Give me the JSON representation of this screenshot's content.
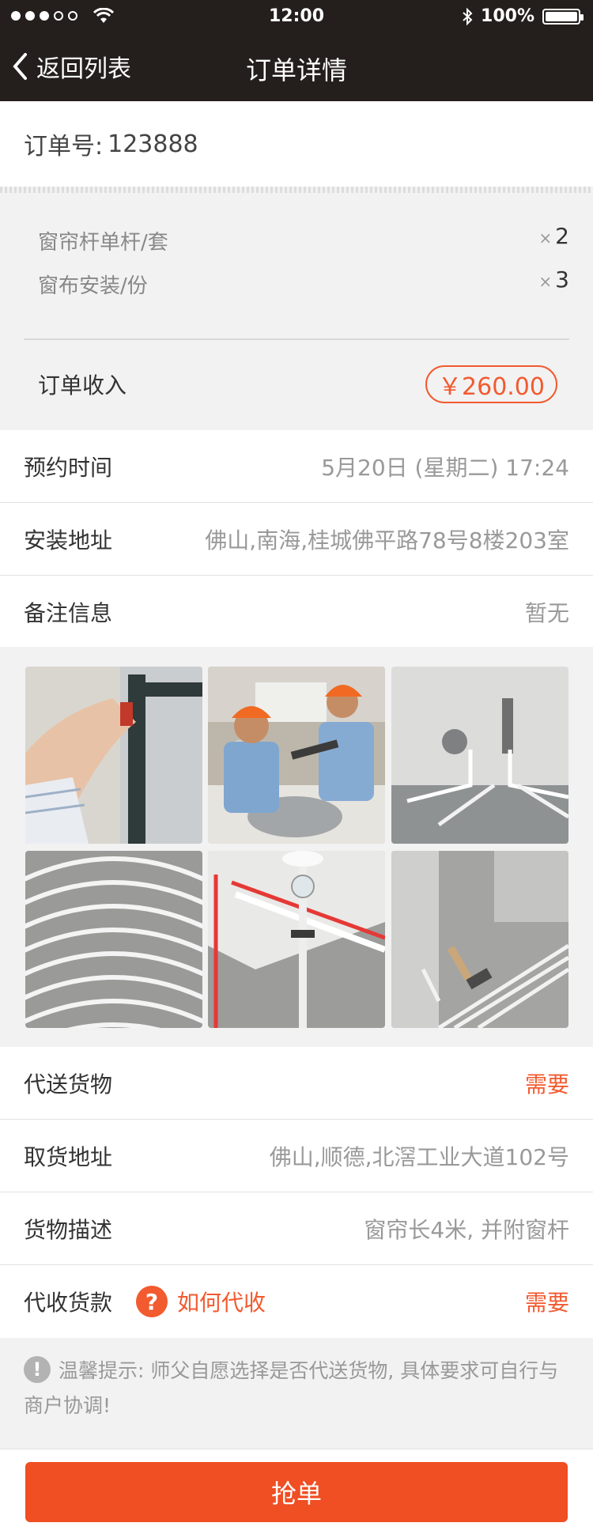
{
  "status": {
    "time": "12:00",
    "battery": "100%",
    "signal_filled": 3,
    "signal_empty": 2
  },
  "nav": {
    "back_label": "返回列表",
    "title": "订单详情"
  },
  "order": {
    "label": "订单号:",
    "number": "123888"
  },
  "items": [
    {
      "name": "窗帘杆单杆/套",
      "qty_prefix": "×",
      "qty": "2"
    },
    {
      "name": "窗布安装/份",
      "qty_prefix": "×",
      "qty": "3"
    }
  ],
  "income": {
    "label": "订单收入",
    "amount": "￥260.00"
  },
  "info": {
    "appointment": {
      "label": "预约时间",
      "value": "5月20日 (星期二) 17:24"
    },
    "address": {
      "label": "安装地址",
      "value": "佛山,南海,桂城佛平路78号8楼203室"
    },
    "remark": {
      "label": "备注信息",
      "value": "暂无"
    }
  },
  "delivery": {
    "deliver": {
      "label": "代送货物",
      "value": "需要"
    },
    "pickup": {
      "label": "取货地址",
      "value": "佛山,顺德,北滘工业大道102号"
    },
    "desc": {
      "label": "货物描述",
      "value": "窗帘长4米, 并附窗杆"
    },
    "cod": {
      "label": "代收货款",
      "help": "如何代收",
      "value": "需要"
    }
  },
  "tip": {
    "text": "温馨提示: 师父自愿选择是否代送货物, 具体要求可自行与商户协调!"
  },
  "action": {
    "grab_label": "抢单"
  },
  "colors": {
    "accent": "#f25a2f",
    "nav_bg": "#241f1c",
    "button": "#f04e23"
  }
}
